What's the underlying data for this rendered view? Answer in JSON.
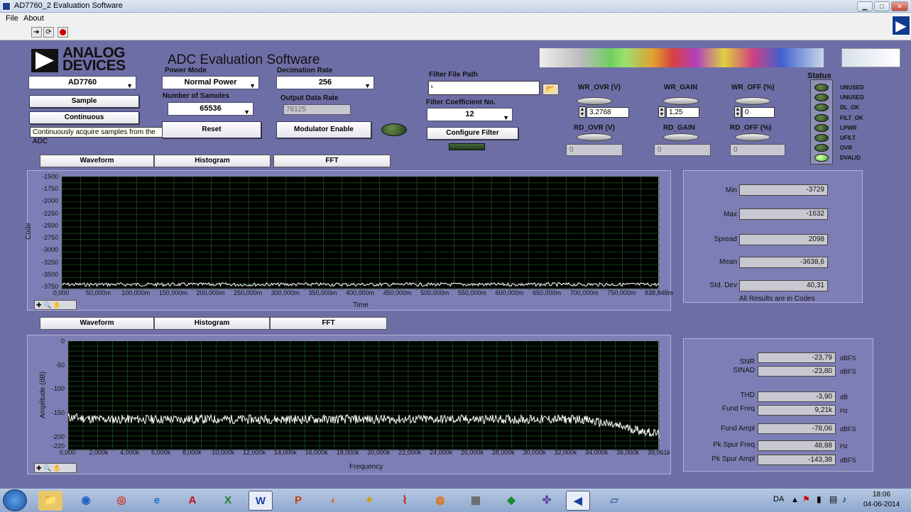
{
  "window": {
    "title": "AD7760_2 Evaluation Software",
    "min": "▁",
    "max": "□",
    "close": "✕"
  },
  "menu": [
    "File",
    "About"
  ],
  "toolbar": {
    "run_icon": "run-arrow-icon",
    "stop_icon": "stop-icon"
  },
  "header": {
    "logo_line1": "ANALOG",
    "logo_line2": "DEVICES",
    "app_title": "ADC Evaluation Software"
  },
  "controls": {
    "device_value": "AD7760",
    "sample_label": "Sample",
    "continuous_label": "Continuous",
    "tooltip": "Continuously acquire samples from the ADC",
    "power_mode_label": "Power Mode",
    "power_mode_value": "Normal Power",
    "num_samples_label": "Number of Samoles",
    "num_samples_value": "65536",
    "reset_label": "Reset",
    "decimation_label": "Decimation Rate",
    "decimation_value": "256",
    "output_rate_label": "Output Data Rate",
    "output_rate_value": "78125",
    "modulator_label": "Modulator Enable",
    "filter_path_label": "Filter File Path",
    "filter_path_value": "",
    "filter_coef_label": "Filter Coefficient No.",
    "filter_coef_value": "12",
    "configure_label": "Configure Filter"
  },
  "registers": {
    "wr_ovr_label": "WR_OVR (V)",
    "wr_ovr_value": "3,2768",
    "wr_gain_label": "WR_GAIN",
    "wr_gain_value": "1,25",
    "wr_off_label": "WR_OFF (%)",
    "wr_off_value": "0",
    "rd_ovr_label": "RD_OVR (V)",
    "rd_ovr_value": "0",
    "rd_gain_label": "RD_GAIN",
    "rd_gain_value": "0",
    "rd_off_label": "RD_OFF (%)",
    "rd_off_value": "0"
  },
  "status": {
    "title": "Status",
    "leds": [
      {
        "label": "UNUSED",
        "on": false
      },
      {
        "label": "UNUSED",
        "on": false
      },
      {
        "label": "DL_OK",
        "on": false
      },
      {
        "label": "FILT_OK",
        "on": false
      },
      {
        "label": "LPWR",
        "on": false
      },
      {
        "label": "UFILT",
        "on": false
      },
      {
        "label": "OVR",
        "on": false
      },
      {
        "label": "DVALID",
        "on": true
      }
    ]
  },
  "tabs1": [
    "Waveform",
    "Histogram",
    "FFT"
  ],
  "tabs2": [
    "Waveform",
    "Histogram",
    "FFT"
  ],
  "time_stats": {
    "min_label": "Min",
    "min": "-3729",
    "max_label": "Max",
    "max": "-1632",
    "spread_label": "Spread",
    "spread": "2098",
    "mean_label": "Mean",
    "mean": "-3638,6",
    "std_label": "Std. Dev",
    "std": "40,31",
    "note": "All Results are in Codes"
  },
  "fft_stats": [
    {
      "label": "SNR",
      "value": "-23,79",
      "unit": "dBFS"
    },
    {
      "label": "SINAD",
      "value": "-23,80",
      "unit": "dBFS"
    },
    {
      "label": "THD",
      "value": "-3,90",
      "unit": "dB"
    },
    {
      "label": "Fund Freq",
      "value": "9,21k",
      "unit": "Hz"
    },
    {
      "label": "Fund Ampl",
      "value": "-78,06",
      "unit": "dBFS"
    },
    {
      "label": "Pk Spur Freq",
      "value": "48,88",
      "unit": "Hz"
    },
    {
      "label": "Pk Spur Ampl",
      "value": "-143,38",
      "unit": "dBFS"
    }
  ],
  "chart_data": [
    {
      "type": "line",
      "xlabel": "Time",
      "ylabel": "Code",
      "ylim": [
        -3750,
        -1500
      ],
      "y_ticks": [
        "-1500",
        "-1750",
        "-2000",
        "-2250",
        "-2500",
        "-2750",
        "-3000",
        "-3250",
        "-3500",
        "-3750"
      ],
      "x_ticks": [
        "0,000",
        "50,000m",
        "100,000m",
        "150,000m",
        "200,000m",
        "250,000m",
        "300,000m",
        "350,000m",
        "400,000m",
        "450,000m",
        "500,000m",
        "550,000m",
        "600,000m",
        "650,000m",
        "700,000m",
        "750,000m",
        "838,848m"
      ],
      "series": [
        {
          "y_level": -3640
        }
      ],
      "grid": true
    },
    {
      "type": "line",
      "xlabel": "Frequency",
      "ylabel": "Amplitude (dB)",
      "ylim": [
        -220,
        0
      ],
      "y_ticks": [
        "0",
        "-50",
        "-100",
        "-150",
        "-200",
        "-220"
      ],
      "x_ticks": [
        "0,000",
        "2,000k",
        "4,000k",
        "6,000k",
        "8,000k",
        "10,000k",
        "12,000k",
        "14,000k",
        "16,000k",
        "18,000k",
        "20,000k",
        "22,000k",
        "24,000k",
        "26,000k",
        "28,000k",
        "30,000k",
        "32,000k",
        "34,000k",
        "36,000k",
        "39,061k"
      ],
      "series": [
        {
          "noise_floor_db": -160,
          "rolloff_start": "34,000k"
        }
      ],
      "grid": true
    }
  ],
  "taskbar": {
    "lang": "DA",
    "time": "18:06",
    "date": "04-06-2014"
  }
}
